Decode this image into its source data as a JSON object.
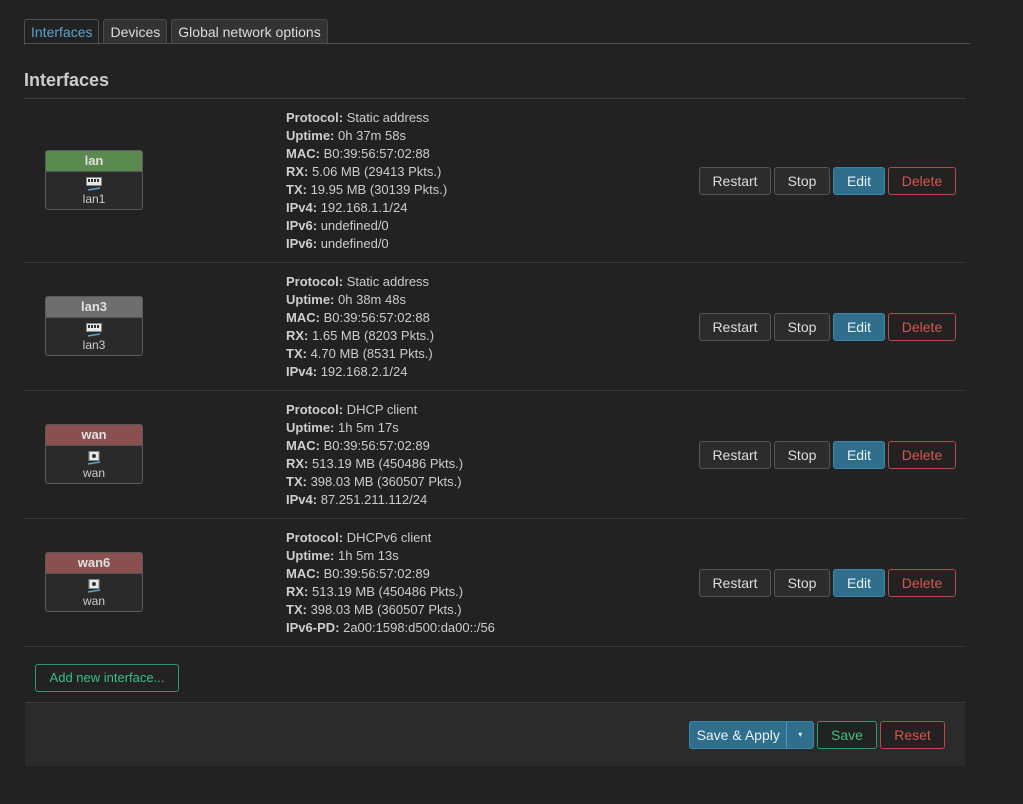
{
  "tabs": [
    "Interfaces",
    "Devices",
    "Global network options"
  ],
  "section_title": "Interfaces",
  "interfaces": [
    {
      "name": "lan",
      "device": "lan1",
      "icon": "ethernet-port-icon",
      "head_color": "#5a8a4f",
      "info": [
        {
          "label": "Protocol:",
          "value": "Static address"
        },
        {
          "label": "Uptime:",
          "value": "0h 37m 58s"
        },
        {
          "label": "MAC:",
          "value": "B0:39:56:57:02:88"
        },
        {
          "label": "RX:",
          "value": "5.06 MB (29413 Pkts.)"
        },
        {
          "label": "TX:",
          "value": "19.95 MB (30139 Pkts.)"
        },
        {
          "label": "IPv4:",
          "value": "192.168.1.1/24"
        },
        {
          "label": "IPv6:",
          "value": "undefined/0"
        },
        {
          "label": "IPv6:",
          "value": "undefined/0"
        }
      ]
    },
    {
      "name": "lan3",
      "device": "lan3",
      "icon": "ethernet-port-icon",
      "head_color": "#6e6e6e",
      "info": [
        {
          "label": "Protocol:",
          "value": "Static address"
        },
        {
          "label": "Uptime:",
          "value": "0h 38m 48s"
        },
        {
          "label": "MAC:",
          "value": "B0:39:56:57:02:88"
        },
        {
          "label": "RX:",
          "value": "1.65 MB (8203 Pkts.)"
        },
        {
          "label": "TX:",
          "value": "4.70 MB (8531 Pkts.)"
        },
        {
          "label": "IPv4:",
          "value": "192.168.2.1/24"
        }
      ]
    },
    {
      "name": "wan",
      "device": "wan",
      "icon": "wan-port-icon",
      "head_color": "#8a4f4f",
      "info": [
        {
          "label": "Protocol:",
          "value": "DHCP client"
        },
        {
          "label": "Uptime:",
          "value": "1h 5m 17s"
        },
        {
          "label": "MAC:",
          "value": "B0:39:56:57:02:89"
        },
        {
          "label": "RX:",
          "value": "513.19 MB (450486 Pkts.)"
        },
        {
          "label": "TX:",
          "value": "398.03 MB (360507 Pkts.)"
        },
        {
          "label": "IPv4:",
          "value": "87.251.211.112/24"
        }
      ]
    },
    {
      "name": "wan6",
      "device": "wan",
      "icon": "wan-port-icon",
      "head_color": "#8a4f4f",
      "info": [
        {
          "label": "Protocol:",
          "value": "DHCPv6 client"
        },
        {
          "label": "Uptime:",
          "value": "1h 5m 13s"
        },
        {
          "label": "MAC:",
          "value": "B0:39:56:57:02:89"
        },
        {
          "label": "RX:",
          "value": "513.19 MB (450486 Pkts.)"
        },
        {
          "label": "TX:",
          "value": "398.03 MB (360507 Pkts.)"
        },
        {
          "label": "IPv6-PD:",
          "value": "2a00:1598:d500:da00::/56"
        }
      ]
    }
  ],
  "row_actions": {
    "restart": "Restart",
    "stop": "Stop",
    "edit": "Edit",
    "delete": "Delete"
  },
  "add_interface_label": "Add new interface...",
  "footer": {
    "save_apply": "Save & Apply",
    "dropdown_glyph": "▾",
    "save": "Save",
    "reset": "Reset"
  }
}
